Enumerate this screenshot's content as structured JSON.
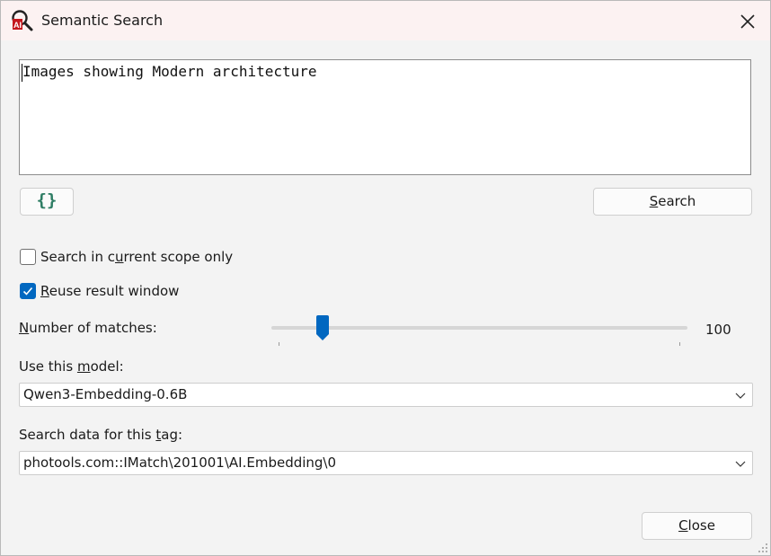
{
  "window": {
    "title": "Semantic Search"
  },
  "query": {
    "value": "Images showing Modern architecture"
  },
  "buttons": {
    "braces_label": "{}",
    "search_pre": "",
    "search_u": "S",
    "search_post": "earch",
    "close_pre": "",
    "close_u": "C",
    "close_post": "lose"
  },
  "options": {
    "scope": {
      "pre": "Search in c",
      "u": "u",
      "post": "rrent scope only",
      "checked": false
    },
    "reuse": {
      "pre": "",
      "u": "R",
      "post": "euse result window",
      "checked": true
    }
  },
  "matches": {
    "label_pre": "",
    "label_u": "N",
    "label_post": "umber of matches:",
    "value": "100",
    "slider_fraction": 0.11
  },
  "model": {
    "label_pre": "Use this ",
    "label_u": "m",
    "label_post": "odel:",
    "selected": "Qwen3-Embedding-0.6B"
  },
  "tag": {
    "label_pre": "Search data for this ",
    "label_u": "t",
    "label_post": "ag:",
    "selected": "photools.com::IMatch\\201001\\AI.Embedding\\0"
  },
  "colors": {
    "accent": "#0067c0",
    "braces": "#2e7d64",
    "icon_red": "#c4161c"
  },
  "icons": [
    "app-icon",
    "close-icon",
    "check-icon",
    "chevron-down-icon",
    "resize-grip-icon"
  ]
}
